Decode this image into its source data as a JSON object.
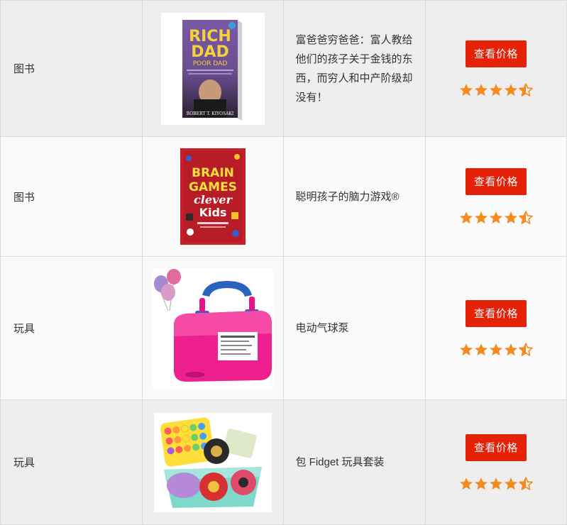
{
  "rows": [
    {
      "category": "图书",
      "description": "富爸爸穷爸爸：富人教给他们的孩子关于金钱的东西，而穷人和中产阶级却没有！",
      "image_kind": "book-rich-dad",
      "cover_text": {
        "line1": "RICH",
        "line2": "DAD",
        "line3": "POOR DAD",
        "author": "ROBERT T. KIYOSAKI"
      },
      "button_label": "查看价格",
      "rating": 4.5
    },
    {
      "category": "图书",
      "description": "聪明孩子的脑力游戏®",
      "image_kind": "book-brain-games",
      "cover_text": {
        "line1": "BRAIN",
        "line2": "GAMES",
        "line3": "clever",
        "line4": "Kids"
      },
      "button_label": "查看价格",
      "rating": 4.5
    },
    {
      "category": "玩具",
      "description": "电动气球泵",
      "image_kind": "balloon-pump",
      "button_label": "查看价格",
      "rating": 4.5
    },
    {
      "category": "玩具",
      "description": "包 Fidget 玩具套装",
      "image_kind": "fidget-set",
      "button_label": "查看价格",
      "rating": 4.5
    }
  ],
  "colors": {
    "button": "#e52207",
    "star": "#f38b1f",
    "row_odd": "#eeeeee",
    "row_even": "#fafafa"
  }
}
